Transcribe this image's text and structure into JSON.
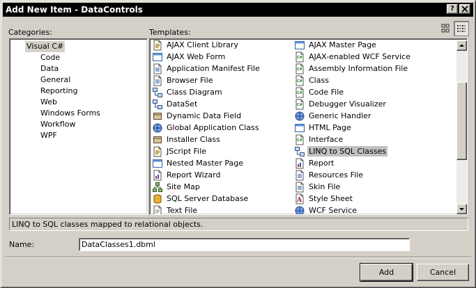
{
  "window": {
    "title": "Add New Item - DataControls",
    "help": "?",
    "close": "✕"
  },
  "categories": {
    "label": "Categories:",
    "items": [
      {
        "label": "Visual C#",
        "level": 0,
        "selected": true
      },
      {
        "label": "Code",
        "level": 1
      },
      {
        "label": "Data",
        "level": 1
      },
      {
        "label": "General",
        "level": 1
      },
      {
        "label": "Reporting",
        "level": 1
      },
      {
        "label": "Web",
        "level": 1
      },
      {
        "label": "Windows Forms",
        "level": 1
      },
      {
        "label": "Workflow",
        "level": 1
      },
      {
        "label": "WPF",
        "level": 1
      }
    ]
  },
  "templates": {
    "label": "Templates:",
    "left_column": [
      {
        "label": "AJAX Client Library",
        "icon": "script-icon"
      },
      {
        "label": "AJAX Web Form",
        "icon": "web-form-icon"
      },
      {
        "label": "Application Manifest File",
        "icon": "manifest-icon"
      },
      {
        "label": "Browser File",
        "icon": "browser-file-icon"
      },
      {
        "label": "Class Diagram",
        "icon": "class-diagram-icon"
      },
      {
        "label": "DataSet",
        "icon": "dataset-icon"
      },
      {
        "label": "Dynamic Data Field",
        "icon": "dynamic-data-icon"
      },
      {
        "label": "Global Application Class",
        "icon": "global-app-icon"
      },
      {
        "label": "Installer Class",
        "icon": "installer-icon"
      },
      {
        "label": "JScript File",
        "icon": "jscript-icon"
      },
      {
        "label": "Nested Master Page",
        "icon": "master-page-icon"
      },
      {
        "label": "Report Wizard",
        "icon": "report-wizard-icon"
      },
      {
        "label": "Site Map",
        "icon": "sitemap-icon"
      },
      {
        "label": "SQL Server Database",
        "icon": "database-icon"
      },
      {
        "label": "Text File",
        "icon": "text-file-icon"
      }
    ],
    "right_column": [
      {
        "label": "AJAX Master Page",
        "icon": "master-page-icon"
      },
      {
        "label": "AJAX-enabled WCF Service",
        "icon": "csharp-file-icon"
      },
      {
        "label": "Assembly Information File",
        "icon": "csharp-file-icon"
      },
      {
        "label": "Class",
        "icon": "csharp-file-icon"
      },
      {
        "label": "Code File",
        "icon": "csharp-file-icon"
      },
      {
        "label": "Debugger Visualizer",
        "icon": "csharp-file-icon"
      },
      {
        "label": "Generic Handler",
        "icon": "handler-icon"
      },
      {
        "label": "HTML Page",
        "icon": "html-page-icon"
      },
      {
        "label": "Interface",
        "icon": "csharp-file-icon"
      },
      {
        "label": "LINQ to SQL Classes",
        "icon": "linq-icon",
        "selected": true
      },
      {
        "label": "Report",
        "icon": "report-icon"
      },
      {
        "label": "Resources File",
        "icon": "resources-icon"
      },
      {
        "label": "Skin File",
        "icon": "skin-file-icon"
      },
      {
        "label": "Style Sheet",
        "icon": "stylesheet-icon"
      },
      {
        "label": "WCF Service",
        "icon": "wcf-icon"
      }
    ]
  },
  "description": "LINQ to SQL classes mapped to relational objects.",
  "name_field": {
    "label": "Name:",
    "value": "DataClasses1.dbml"
  },
  "buttons": {
    "add": "Add",
    "cancel": "Cancel"
  },
  "colors": {
    "titlebar": "#000000",
    "face": "#d4d0c8",
    "selection": "#c0c0c0"
  }
}
